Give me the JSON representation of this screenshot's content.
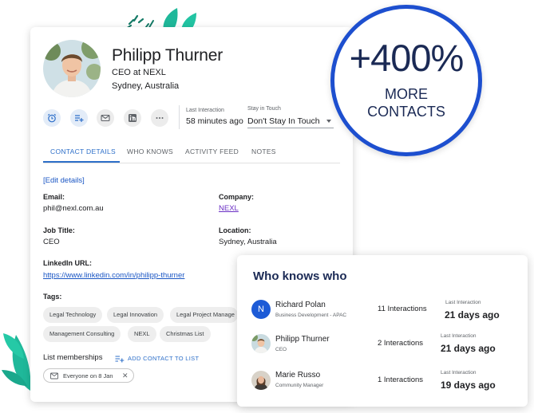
{
  "profile": {
    "name": "Philipp Thurner",
    "role": "CEO at NEXL",
    "location": "Sydney, Australia"
  },
  "actions": [
    {
      "icon": "alarm-clock-icon"
    },
    {
      "icon": "add-to-list-icon"
    },
    {
      "icon": "email-icon"
    },
    {
      "icon": "linkedin-icon"
    },
    {
      "icon": "more-icon"
    }
  ],
  "last_interaction": {
    "label": "Last Interaction",
    "value": "58 minutes ago"
  },
  "stay_in_touch": {
    "label": "Stay in Touch",
    "value": "Don't Stay In Touch"
  },
  "tabs": [
    {
      "label": "CONTACT DETAILS",
      "active": true
    },
    {
      "label": "WHO KNOWS",
      "active": false
    },
    {
      "label": "ACTIVITY FEED",
      "active": false
    },
    {
      "label": "NOTES",
      "active": false
    }
  ],
  "details": {
    "edit_link": "[Edit details]",
    "email_label": "Email:",
    "email_value": "phil@nexl.com.au",
    "company_label": "Company:",
    "company_value": "NEXL",
    "job_label": "Job Title:",
    "job_value": "CEO",
    "location_label": "Location:",
    "location_value": "Sydney, Australia",
    "linkedin_label": "LinkedIn URL:",
    "linkedin_value": "https://www.linkedin.com/in/philipp-thurner"
  },
  "tags": {
    "label": "Tags:",
    "items": [
      "Legal Technology",
      "Legal Innovation",
      "Legal Project Manage",
      "Management Consulting",
      "NEXL",
      "Christmas List"
    ]
  },
  "list_memberships": {
    "label": "List memberships",
    "action": "ADD CONTACT TO LIST",
    "chip": "Everyone on 8 Jan",
    "chip_close": "✕"
  },
  "badge": {
    "big": "+400%",
    "line1": "MORE",
    "line2": "CONTACTS"
  },
  "who_knows": {
    "title": "Who knows who",
    "rows": [
      {
        "initial": "N",
        "name": "Richard Polan",
        "subtitle": "Business Development - APAC",
        "interactions": "11 Interactions",
        "last_label": "Last Interaction",
        "last_value": "21 days ago"
      },
      {
        "initial": "",
        "name": "Philipp Thurner",
        "subtitle": "CEO",
        "interactions": "2 Interactions",
        "last_label": "Last Interaction",
        "last_value": "21 days ago"
      },
      {
        "initial": "",
        "name": "Marie Russo",
        "subtitle": "Community Manager",
        "interactions": "1 Interactions",
        "last_label": "Last Interaction",
        "last_value": "19 days ago"
      }
    ]
  },
  "colors": {
    "accent": "#2d6fc9",
    "badge_ring": "#1d4fcf",
    "badge_text": "#1b2a55",
    "leaf": "#1fb89a"
  }
}
